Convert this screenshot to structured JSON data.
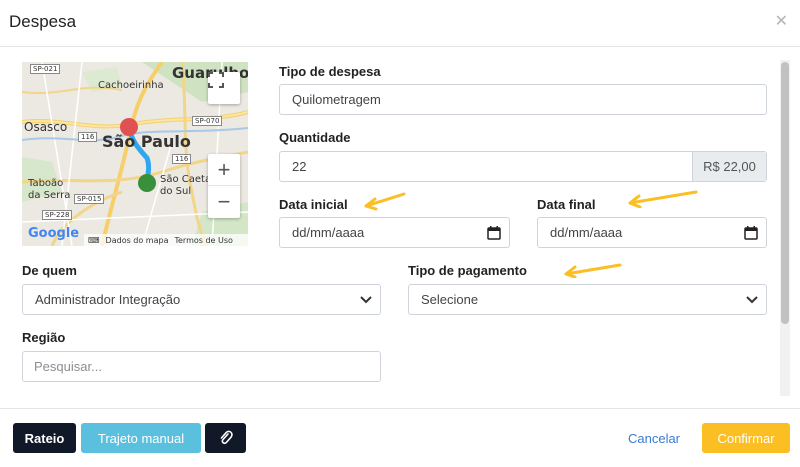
{
  "modal": {
    "title": "Despesa"
  },
  "map": {
    "labels": {
      "guarulhos": "Guarulhos",
      "cachoeirinha": "Cachoeirinha",
      "osasco": "Osasco",
      "sao_paulo": "São Paulo",
      "taboao": "Taboão",
      "da_serra": "da Serra",
      "sao_caetano": "São Caetano",
      "do_sul": "do Sul",
      "sp021": "SP-021",
      "sp070": "SP-070",
      "sp015": "SP-015",
      "sp228": "SP-228",
      "r116a": "116",
      "r116b": "116",
      "google": "Google"
    },
    "attribution": {
      "data": "Dados do mapa",
      "terms": "Termos de Uso"
    },
    "zoom_in": "+",
    "zoom_out": "−"
  },
  "form": {
    "tipo_despesa": {
      "label": "Tipo de despesa",
      "value": "Quilometragem"
    },
    "quantidade": {
      "label": "Quantidade",
      "value": "22",
      "addon": "R$ 22,00"
    },
    "data_inicial": {
      "label": "Data inicial",
      "value": "dd/mm/aaaa"
    },
    "data_final": {
      "label": "Data final",
      "value": "dd/mm/aaaa"
    },
    "de_quem": {
      "label": "De quem",
      "value": "Administrador Integração"
    },
    "tipo_pagamento": {
      "label": "Tipo de pagamento",
      "value": "Selecione"
    },
    "regiao": {
      "label": "Região",
      "placeholder": "Pesquisar..."
    }
  },
  "footer": {
    "rateio": "Rateio",
    "trajeto_manual": "Trajeto manual",
    "cancelar": "Cancelar",
    "confirmar": "Confirmar"
  },
  "colors": {
    "arrow": "#fbbf24",
    "origin_marker": "#e05252",
    "destination_marker": "#3a8f3a",
    "route": "#2ea7f0"
  }
}
